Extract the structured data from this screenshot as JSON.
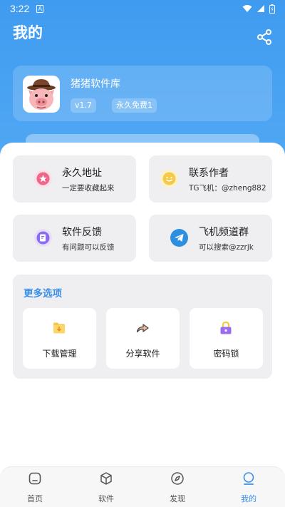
{
  "status_bar": {
    "time": "3:22",
    "notification_glyph": "A"
  },
  "header": {
    "title": "我的",
    "share_icon": "share-icon"
  },
  "profile": {
    "app_name": "猪猪软件库",
    "version_badge": "v1.7",
    "license_badge": "永久免费1"
  },
  "tiles": [
    {
      "title": "永久地址",
      "subtitle": "一定要收藏起来",
      "icon": "star-badge-icon",
      "icon_color": "#F0658A"
    },
    {
      "title": "联系作者",
      "subtitle": "TG飞机：@zheng882",
      "icon": "smile-chat-icon",
      "icon_color": "#F6C94A"
    },
    {
      "title": "软件反馈",
      "subtitle": "有问题可以反馈",
      "icon": "feedback-note-icon",
      "icon_color": "#8B6CF0"
    },
    {
      "title": "飞机频道群",
      "subtitle": "可以搜索@zzrjk",
      "icon": "telegram-icon",
      "icon_color": "#2D8FE0"
    }
  ],
  "more_options": {
    "title": "更多选项",
    "items": [
      {
        "label": "下载管理",
        "icon": "download-folder-icon"
      },
      {
        "label": "分享软件",
        "icon": "share-arrow-icon"
      },
      {
        "label": "密码锁",
        "icon": "lock-icon"
      }
    ]
  },
  "tabbar": {
    "items": [
      {
        "label": "首页",
        "icon": "home-icon",
        "active": false
      },
      {
        "label": "软件",
        "icon": "cube-icon",
        "active": false
      },
      {
        "label": "发现",
        "icon": "compass-icon",
        "active": false
      },
      {
        "label": "我的",
        "icon": "user-icon",
        "active": true
      }
    ]
  },
  "colors": {
    "header_blue": "#3F9BF0",
    "accent": "#3B8FE8",
    "tile_bg": "#EFEFF1"
  }
}
